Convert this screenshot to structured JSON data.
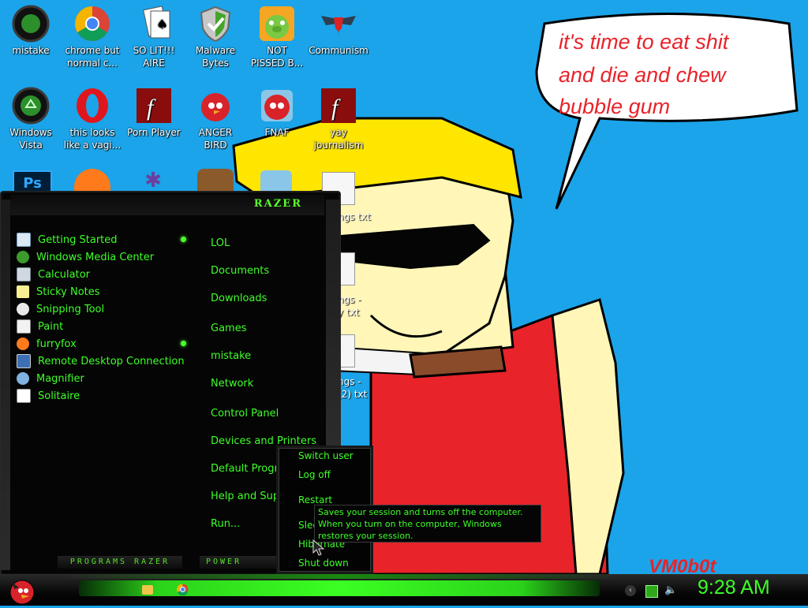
{
  "desktop": {
    "icons": [
      {
        "label": "mistake"
      },
      {
        "label": "chrome but\nnormal c..."
      },
      {
        "label": "SO LIT!!!\nAIRE"
      },
      {
        "label": "Malware\nBytes"
      },
      {
        "label": "NOT\nPISSED B..."
      },
      {
        "label": "Communism"
      },
      {
        "label": "Windows\nVista"
      },
      {
        "label": "this looks\nlike a vagi..."
      },
      {
        "label": "Porn Player"
      },
      {
        "label": "ANGER\nBIRD"
      },
      {
        "label": "FNAF"
      },
      {
        "label": "yay\njournalism"
      }
    ],
    "partial_labels": [
      "ngs txt",
      "ngs -\ny txt",
      "ngs -\n(2) txt"
    ]
  },
  "wallpaper": {
    "speech_lines": [
      "it's time to eat shit",
      "and die and chew",
      "bubble gum"
    ],
    "signature": "VM0b0t",
    "colors": {
      "sky": "#1ba4e9",
      "hair": "#ffe600",
      "shirt": "#e8232a",
      "skin": "#fff6b8",
      "text": "#e8232a"
    }
  },
  "start_menu": {
    "brand": "RAZER",
    "programs": [
      {
        "label": "Getting Started",
        "has_submenu": true,
        "icon": "getting-started-icon"
      },
      {
        "label": "Windows Media Center",
        "has_submenu": false,
        "icon": "media-center-icon"
      },
      {
        "label": "Calculator",
        "has_submenu": false,
        "icon": "calculator-icon"
      },
      {
        "label": "Sticky Notes",
        "has_submenu": false,
        "icon": "sticky-notes-icon"
      },
      {
        "label": "Snipping Tool",
        "has_submenu": false,
        "icon": "snipping-tool-icon"
      },
      {
        "label": "Paint",
        "has_submenu": false,
        "icon": "paint-icon"
      },
      {
        "label": "furryfox",
        "has_submenu": true,
        "icon": "firefox-icon"
      },
      {
        "label": "Remote Desktop Connection",
        "has_submenu": false,
        "icon": "remote-desktop-icon"
      },
      {
        "label": "Magnifier",
        "has_submenu": false,
        "icon": "magnifier-icon"
      },
      {
        "label": "Solitaire",
        "has_submenu": false,
        "icon": "solitaire-icon"
      }
    ],
    "places": [
      "LOL",
      "Documents",
      "Downloads",
      "Games",
      "mistake",
      "Network",
      "Control Panel",
      "Devices and Printers",
      "Default Programs",
      "Help and Support",
      "Run..."
    ],
    "programs_button": "PROGRAMS",
    "programs_brand": "RAZER",
    "power_button": "POWER"
  },
  "power_submenu": {
    "items": [
      "Switch user",
      "Log off",
      "Restart",
      "Sleep",
      "Hibernate",
      "Shut down"
    ],
    "tooltip": "Saves your session and turns off the computer. When you turn on the computer, Windows restores your session."
  },
  "taskbar": {
    "clock": "9:28 AM",
    "accent": "#3dff28"
  }
}
